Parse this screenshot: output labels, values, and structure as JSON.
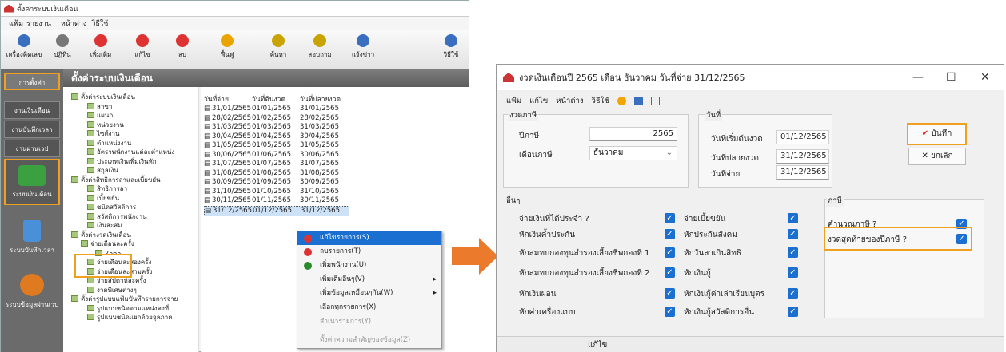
{
  "left": {
    "title": "ตั้งค่าระบบเงินเดือน",
    "menu": [
      "แฟ้ม",
      "รายงาน",
      "หน้าต่าง",
      "วิธีใช้"
    ],
    "toolbar": [
      {
        "label": "เครื่องคิดเลข",
        "icon": "calculator-icon",
        "color": "#3a6fc0"
      },
      {
        "label": "ปฏิทิน",
        "icon": "calendar-icon",
        "color": "#777"
      },
      {
        "label": "เพิ่มเติม",
        "icon": "add-icon",
        "color": "#d33"
      },
      {
        "label": "แก้ไข",
        "icon": "edit-icon",
        "color": "#d33"
      },
      {
        "label": "ลบ",
        "icon": "delete-icon",
        "color": "#d33"
      },
      {
        "label": "ฟื้นฟู",
        "icon": "refresh-icon",
        "color": "#e9a400"
      },
      {
        "label": "ค้นหา",
        "icon": "search-icon",
        "color": "#c9a400"
      },
      {
        "label": "สอบถาม",
        "icon": "query-icon",
        "color": "#c9a400"
      },
      {
        "label": "แจ้งข่าว",
        "icon": "news-icon",
        "color": "#3a6fc0"
      },
      {
        "label": "วิธีใช้",
        "icon": "help-icon",
        "color": "#3a6fc0"
      }
    ],
    "side": {
      "setup": "การตั้งค่า",
      "salary_work": "งานเงินเดือน",
      "time_work": "งานบันทึกเวลา",
      "via_work": "งานผ่านเวป",
      "payroll_system": "ระบบเงินเดือน",
      "time_system": "ระบบบันทึกเวลา",
      "web_system": "ระบบข้อมูลผ่านเวป"
    },
    "header": "ตั้งค่าระบบเงินเดือน",
    "tree": [
      "ตั้งค่าระบบเงินเดือน",
      "สาขา",
      "แผนก",
      "หน่วยงาน",
      "ไซต์งาน",
      "ตำแหน่งงาน",
      "อัตราพนักงานแต่ละตำแหน่ง",
      "ประเภทเงินเพิ่มเงินหัก",
      "สกุลเงิน",
      "ตั้งค่าสิทธิการลาและเบี้ยขยัน",
      "สิทธิการลา",
      "เบี้ยขยัน",
      "ชนิดสวัสดิการ",
      "สวัสดิการพนักงาน",
      "เงินสะสม",
      "ตั้งค่างวดเงินเดือน",
      "จ่ายเดือนละครั้ง",
      "2565",
      "จ่ายเดือนละสองครั้ง",
      "จ่ายเดือนละสามครั้ง",
      "จ่ายสัปดาห์ละครั้ง",
      "งวดพิเศษต่างๆ",
      "ตั้งค่ารูปแบบแฟ้มบันทึกรายการจ่าย",
      "รูปแบบชนิดตามแหน่งคงที่",
      "รูปแบบชนิดแยกด้วยจุลภาค"
    ],
    "list_headers": [
      "วันที่จ่าย",
      "วันที่ต้นงวด",
      "วันที่ปลายงวด"
    ],
    "rows": [
      [
        "31/01/2565",
        "01/01/2565",
        "31/01/2565"
      ],
      [
        "28/02/2565",
        "01/02/2565",
        "28/02/2565"
      ],
      [
        "31/03/2565",
        "01/03/2565",
        "31/03/2565"
      ],
      [
        "30/04/2565",
        "01/04/2565",
        "30/04/2565"
      ],
      [
        "31/05/2565",
        "01/05/2565",
        "31/05/2565"
      ],
      [
        "30/06/2565",
        "01/06/2565",
        "30/06/2565"
      ],
      [
        "31/07/2565",
        "01/07/2565",
        "31/07/2565"
      ],
      [
        "31/08/2565",
        "01/08/2565",
        "31/08/2565"
      ],
      [
        "30/09/2565",
        "01/09/2565",
        "30/09/2565"
      ],
      [
        "31/10/2565",
        "01/10/2565",
        "31/10/2565"
      ],
      [
        "30/11/2565",
        "01/11/2565",
        "30/11/2565"
      ],
      [
        "31/12/2565",
        "01/12/2565",
        "31/12/2565"
      ]
    ],
    "context_menu": [
      "แก้ไขรายการ(S)",
      "ลบรายการ(T)",
      "เพิ่มพนักงาน(U)",
      "เพิ่มเติมอื่นๆ(V)",
      "เพิ่มข้อมูลเหมือนๆกัน(W)",
      "เลือกทุกรายการ(X)",
      "สำเนารายการ(Y)",
      "ตั้งค่าความสำคัญของข้อมูล(Z)"
    ]
  },
  "right": {
    "title": "งวดเงินเดือนปี 2565 เดือน ธันวาคม วันที่จ่าย 31/12/2565",
    "menu": [
      "แฟ้ม",
      "แก้ไข",
      "หน้าต่าง",
      "วิธีใช้"
    ],
    "period_group": "งวดภาษี",
    "tax_year_label": "ปีภาษี",
    "tax_year": "2565",
    "tax_month_label": "เดือนภาษี",
    "tax_month": "ธันวาคม",
    "date_group": "วันที่",
    "start_label": "วันที่เริ่มต้นงวด",
    "start": "01/12/2565",
    "end_label": "วันที่ปลายงวด",
    "end": "31/12/2565",
    "pay_label": "วันที่จ่าย",
    "pay": "31/12/2565",
    "save": "บันทึก",
    "cancel": "ยกเลิก",
    "other_group": "อื่นๆ",
    "left_checks": [
      "จ่ายเงินที่ได้ประจำ ?",
      "หักเงินค้ำประกัน",
      "หักสมทบกองทุนสำรองเลี้ยงชีพกองที่ 1",
      "หักสมทบกองทุนสำรองเลี้ยงชีพกองที่ 2",
      "หักเงินผ่อน",
      "หักค่าเครื่องแบบ"
    ],
    "right_checks": [
      "จ่ายเบี้ยขยัน",
      "หักประกันสังคม",
      "หักวันลาเกินสิทธิ",
      "หักเงินกู้",
      "หักเงินกู้ค่าเล่าเรียนบุตร",
      "หักเงินกู้สวัสดิการอื่น"
    ],
    "tax_group": "ภาษี",
    "tax_checks": [
      "คำนวณภาษี ?",
      "งวดสุดท้ายของปีภาษี ?"
    ],
    "status": "แก้ไข"
  }
}
